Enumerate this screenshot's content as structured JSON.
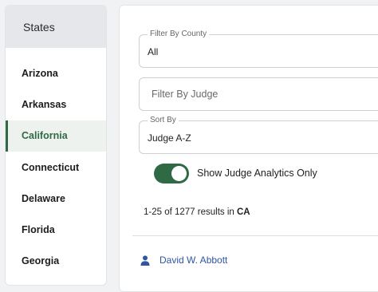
{
  "sidebar": {
    "title": "States",
    "items": [
      {
        "label": "Arizona"
      },
      {
        "label": "Arkansas"
      },
      {
        "label": "California"
      },
      {
        "label": "Connecticut"
      },
      {
        "label": "Delaware"
      },
      {
        "label": "Florida"
      },
      {
        "label": "Georgia"
      }
    ],
    "active": "California"
  },
  "filters": {
    "county": {
      "legend": "Filter By County",
      "value": "All"
    },
    "judge": {
      "placeholder": "Filter By Judge",
      "value": ""
    },
    "sort": {
      "legend": "Sort By",
      "value": "Judge A-Z"
    }
  },
  "toggle": {
    "label": "Show Judge Analytics Only",
    "on": true
  },
  "results": {
    "summary": "1-25 of 1277 results in ",
    "state": "CA"
  },
  "judges": [
    {
      "name": "David W. Abbott",
      "icon": "person-icon"
    }
  ],
  "colors": {
    "accent": "#2f6a45",
    "link": "#2f55a4",
    "active_bg": "#edf2ef"
  }
}
